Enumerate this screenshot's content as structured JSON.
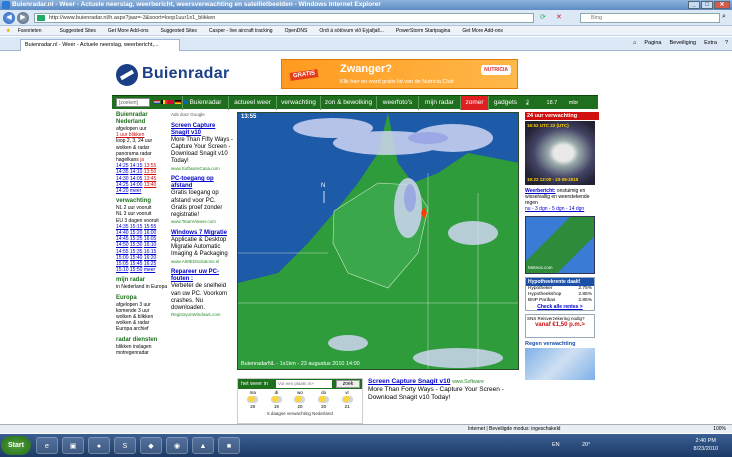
{
  "window": {
    "title": "Buienradar.nl - Weer - Actuele neerslag, weerbericht, weersverwachting en satellietbeelden - Windows Internet Explorer"
  },
  "address": {
    "url": "http://www.buienradar.nl/h.aspx?jaar=-3&soort=loop1uur1x1_blikken",
    "search_placeholder": "Bing"
  },
  "favorites": {
    "label": "Favorieten",
    "items": [
      "Suggested Sites",
      "Get More Add-ons",
      "Suggested Sites",
      "Casper - live aircraft tracking",
      "OpenDNS",
      "Ordi á sötövum við Eyjafjall...",
      "PowerStorm Startpagina",
      "Get More Add-ons"
    ]
  },
  "tab": {
    "label": "Buienradar.nl - Weer - Actuele neerslag, weerbericht,..."
  },
  "commandbar": {
    "items": [
      "Pagina",
      "Beveiliging",
      "Extra",
      "?"
    ]
  },
  "site": {
    "logo_text": "Buienradar",
    "banner": {
      "badge": "GRATIS",
      "headline": "Zwanger?",
      "sub": "Klik hier en word gratis lid van de Nutricia Club",
      "brand": "NUTRICIA"
    },
    "search_placeholder": "[zoeken]",
    "nav": [
      "Buienradar",
      "actueel weer",
      "verwachting",
      "zon & bewolking",
      "weerfoto's",
      "mijn radar",
      "zomer",
      "gadgets"
    ],
    "nav_right": {
      "temp": "18.7",
      "unit": "mbr"
    }
  },
  "left": {
    "heading": "Buienradar Nederland",
    "text": [
      "afgelopen uur",
      "1 uur blikken",
      "loop 2, 3, 24 uur",
      "wolken & radar",
      "panorama radar",
      "hagelkans",
      "ja"
    ],
    "times": [
      [
        "14:25",
        "14:15",
        "13:55"
      ],
      [
        "14:35",
        "14:10",
        "13:50"
      ],
      [
        "14:30",
        "14:05",
        "13:45"
      ],
      [
        "14:25",
        "14:00",
        "13:40"
      ],
      [
        "14:20",
        "meer",
        ""
      ]
    ],
    "forecast_heading": "verwachting",
    "forecast_text": [
      "NL 2 uur vooruit",
      "NL 3 uur vooruit",
      "EU 3 dagen vooruit"
    ],
    "forecast_times": [
      [
        "14:35",
        "15:15",
        "15:55"
      ],
      [
        "14:40",
        "15:20",
        "16:00"
      ],
      [
        "14:45",
        "15:25",
        "16:05"
      ],
      [
        "14:50",
        "15:30",
        "16:10"
      ],
      [
        "14:55",
        "15:35",
        "16:15"
      ],
      [
        "15:00",
        "15:40",
        "16:20"
      ],
      [
        "15:05",
        "15:45",
        "16:25"
      ],
      [
        "15:10",
        "15:50",
        "meer"
      ]
    ],
    "mijn_radar": "mijn radar",
    "mijn_text": "in Nederland in Europa",
    "europa": "Europa",
    "europa_text": [
      "afgelopen 3 uur",
      "komende 3 uur",
      "wolken & blikken",
      "wolken & radar",
      "Europa archief"
    ],
    "radar_diensten": "radar diensten",
    "radar_text": [
      "blikken inslagen",
      "motregenradar"
    ]
  },
  "ads": {
    "label": "Ads door Google",
    "items": [
      {
        "title": "Screen Capture Snagit v10",
        "desc": "More Than Fifty Ways - Capture Your Screen - Download Snagit v10 Today!",
        "url": "www.SoftwareCasa.com"
      },
      {
        "title": "PC-toegang op afstand",
        "desc": "Gratis toegang op afstand voor PC. Gratis proef zonder registratie!",
        "url": "www.TeamViewer.com"
      },
      {
        "title": "Windows 7 Migratie",
        "desc": "Applicatie & Desktop Migratie Automatic Imaging & Packaging",
        "url": "www.AIMEDSolutions.nl"
      },
      {
        "title": "Repareer uw PC-fouten :",
        "desc": "Verbeter de snelheid van uw PC. Voorkom crashes. Nu downloaden.",
        "url": "RegistryonWindows.com"
      }
    ]
  },
  "map": {
    "time": "13:55",
    "caption": "BuienradarNL - 1x1km - 23 augustus 2010 14:00"
  },
  "weather": {
    "label": "het weer in",
    "input_placeholder": "Vul een plaats in>",
    "go": "zoek",
    "days": [
      {
        "d": "ma",
        "t": "20"
      },
      {
        "d": "di",
        "t": "19"
      },
      {
        "d": "wo",
        "t": "20"
      },
      {
        "d": "do",
        "t": "20"
      },
      {
        "d": "vr",
        "t": "21"
      }
    ],
    "note": "5 daagse verwachting Nederland"
  },
  "ad2": {
    "title": "Screen Capture Snagit v10",
    "url": "www.Software",
    "desc": "More Than Forty Ways - Capture Your Screen - Download Snagit v10 Today!"
  },
  "right": {
    "box_heading": "24 uur verwachting",
    "sat_top": "16:52 UTC 22 (UTC)",
    "sat_bottom": "19:22 12:00 - 23-08-2010",
    "weerbericht_label": "Weerbericht:",
    "weerbericht_text": "onstuimig en wisselvallig en weerstekende regen",
    "weerbericht_links": "nu - 3 dgn - 5 dgn - 14 dgn",
    "radar_caption": "Meteox.com",
    "hyp_heading": "Hypotheekrente daalt!",
    "hyp_rows": [
      [
        "Hypotheker",
        "2.75%"
      ],
      [
        "Hypotheekshop",
        "2.85%"
      ],
      [
        "BNP Paribas",
        "2.85%"
      ]
    ],
    "hyp_all": "Check alle rentes >",
    "sns_label": "SNS Reisverzekering nodig?",
    "sns_price": "vanaf €1,50 p.m.>",
    "regen_label": "Regen verwachting"
  },
  "status": {
    "text": "Internet | Beveiligde modus: ingeschakeld",
    "zoom": "100%"
  },
  "taskbar": {
    "start": "Start",
    "lang": "EN",
    "temp": "20°",
    "time": "2:40 PM",
    "date": "8/23/2010"
  }
}
